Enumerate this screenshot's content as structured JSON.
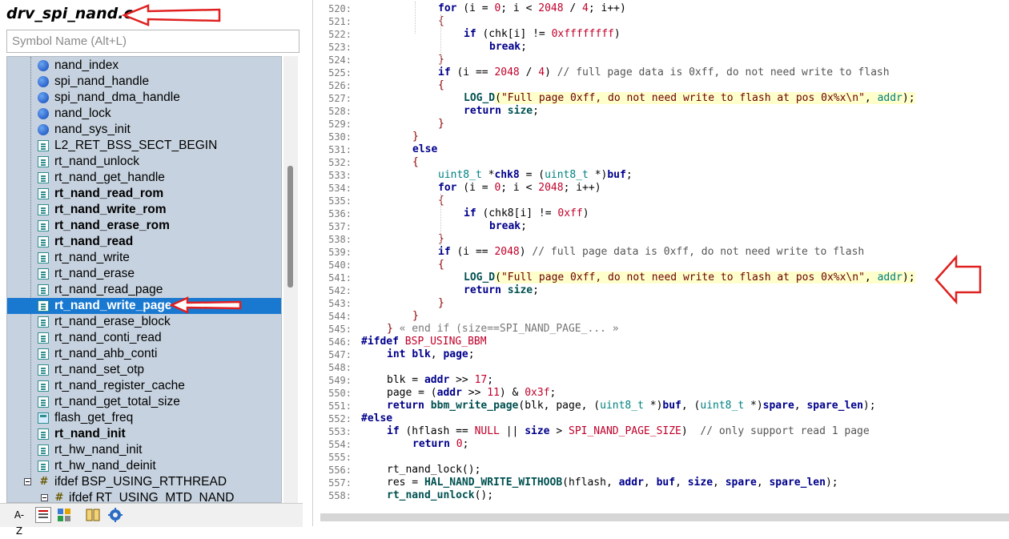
{
  "file_title": "drv_spi_nand.c",
  "search": {
    "placeholder": "Symbol Name (Alt+L)"
  },
  "tree": [
    {
      "label": "nand_index",
      "icon": "variable-icon",
      "bold": false,
      "selected": false
    },
    {
      "label": "spi_nand_handle",
      "icon": "variable-icon",
      "bold": false,
      "selected": false
    },
    {
      "label": "spi_nand_dma_handle",
      "icon": "variable-icon",
      "bold": false,
      "selected": false
    },
    {
      "label": "nand_lock",
      "icon": "variable-icon",
      "bold": false,
      "selected": false
    },
    {
      "label": "nand_sys_init",
      "icon": "variable-icon",
      "bold": false,
      "selected": false
    },
    {
      "label": "L2_RET_BSS_SECT_BEGIN",
      "icon": "function-icon",
      "bold": false,
      "selected": false
    },
    {
      "label": "rt_nand_unlock",
      "icon": "function-icon",
      "bold": false,
      "selected": false
    },
    {
      "label": "rt_nand_get_handle",
      "icon": "function-icon",
      "bold": false,
      "selected": false
    },
    {
      "label": "rt_nand_read_rom",
      "icon": "function-icon",
      "bold": true,
      "selected": false
    },
    {
      "label": "rt_nand_write_rom",
      "icon": "function-icon",
      "bold": true,
      "selected": false
    },
    {
      "label": "rt_nand_erase_rom",
      "icon": "function-icon",
      "bold": true,
      "selected": false
    },
    {
      "label": "rt_nand_read",
      "icon": "function-icon",
      "bold": true,
      "selected": false
    },
    {
      "label": "rt_nand_write",
      "icon": "function-icon",
      "bold": false,
      "selected": false
    },
    {
      "label": "rt_nand_erase",
      "icon": "function-icon",
      "bold": false,
      "selected": false
    },
    {
      "label": "rt_nand_read_page",
      "icon": "function-icon",
      "bold": false,
      "selected": false
    },
    {
      "label": "rt_nand_write_page",
      "icon": "function-icon",
      "bold": true,
      "selected": true
    },
    {
      "label": "rt_nand_erase_block",
      "icon": "function-icon",
      "bold": false,
      "selected": false
    },
    {
      "label": "rt_nand_conti_read",
      "icon": "function-icon",
      "bold": false,
      "selected": false
    },
    {
      "label": "rt_nand_ahb_conti",
      "icon": "function-icon",
      "bold": false,
      "selected": false
    },
    {
      "label": "rt_nand_set_otp",
      "icon": "function-icon",
      "bold": false,
      "selected": false
    },
    {
      "label": "rt_nand_register_cache",
      "icon": "function-icon",
      "bold": false,
      "selected": false
    },
    {
      "label": "rt_nand_get_total_size",
      "icon": "function-icon",
      "bold": false,
      "selected": false
    },
    {
      "label": "flash_get_freq",
      "icon": "function-prototype-icon",
      "bold": false,
      "selected": false
    },
    {
      "label": "rt_nand_init",
      "icon": "function-icon",
      "bold": true,
      "selected": false
    },
    {
      "label": "rt_hw_nand_init",
      "icon": "function-icon",
      "bold": false,
      "selected": false
    },
    {
      "label": "rt_hw_nand_deinit",
      "icon": "function-icon",
      "bold": false,
      "selected": false
    }
  ],
  "tree_groups": [
    {
      "label": "ifdef BSP_USING_RTTHREAD",
      "icon": "preprocessor-icon"
    },
    {
      "label": "ifdef RT_USING_MTD_NAND",
      "icon": "preprocessor-icon"
    }
  ],
  "toolbar": {
    "sort_label": "A-Z"
  },
  "line_numbers": [
    "520:",
    "521:",
    "522:",
    "523:",
    "524:",
    "525:",
    "526:",
    "527:",
    "528:",
    "529:",
    "530:",
    "531:",
    "532:",
    "533:",
    "534:",
    "535:",
    "536:",
    "537:",
    "538:",
    "539:",
    "540:",
    "541:",
    "542:",
    "543:",
    "544:",
    "545:",
    "546:",
    "547:",
    "548:",
    "549:",
    "550:",
    "551:",
    "552:",
    "553:",
    "554:",
    "555:",
    "556:",
    "557:",
    "558:"
  ],
  "code": {
    "l520": [
      [
        "kw",
        "for"
      ],
      [
        "t",
        " (i = "
      ],
      [
        "num",
        "0"
      ],
      [
        "t",
        "; i < "
      ],
      [
        "num",
        "2048"
      ],
      [
        "t",
        " / "
      ],
      [
        "num",
        "4"
      ],
      [
        "t",
        "; i++)"
      ]
    ],
    "l521": [
      [
        "br",
        "{"
      ]
    ],
    "l522": [
      [
        "kw",
        "if"
      ],
      [
        "t",
        " (chk[i] != "
      ],
      [
        "num",
        "0xffffffff"
      ],
      [
        "t",
        ")"
      ]
    ],
    "l523": [
      [
        "kw",
        "break"
      ],
      [
        "t",
        ";"
      ]
    ],
    "l524": [
      [
        "br",
        "}"
      ]
    ],
    "l525": [
      [
        "kw",
        "if"
      ],
      [
        "t",
        " (i == "
      ],
      [
        "num",
        "2048"
      ],
      [
        "t",
        " / "
      ],
      [
        "num",
        "4"
      ],
      [
        "t",
        ") "
      ],
      [
        "cmt",
        "// full page data is 0xff, do not need write to flash"
      ]
    ],
    "l526": [
      [
        "br",
        "{"
      ]
    ],
    "l527": [
      [
        "fnc",
        "LOG_D"
      ],
      [
        "t",
        "("
      ],
      [
        "str",
        "\"Full page 0xff, do not need write to flash at pos 0x%x\\n\""
      ],
      [
        "t",
        ", "
      ],
      [
        "teal",
        "addr"
      ],
      [
        "t",
        ");"
      ]
    ],
    "l528": [
      [
        "kw",
        "return"
      ],
      [
        "t",
        " "
      ],
      [
        "fnc",
        "size"
      ],
      [
        "t",
        ";"
      ]
    ],
    "l529": [
      [
        "br",
        "}"
      ]
    ],
    "l530": [
      [
        "br",
        "}"
      ]
    ],
    "l531": [
      [
        "kw",
        "else"
      ]
    ],
    "l532": [
      [
        "br",
        "{"
      ]
    ],
    "l533": [
      [
        "teal",
        "uint8_t"
      ],
      [
        "t",
        " *"
      ],
      [
        "kw",
        "chk8"
      ],
      [
        "t",
        " = ("
      ],
      [
        "teal",
        "uint8_t"
      ],
      [
        "t",
        " *)"
      ],
      [
        "kw",
        "buf"
      ],
      [
        "t",
        ";"
      ]
    ],
    "l534": [
      [
        "kw",
        "for"
      ],
      [
        "t",
        " (i = "
      ],
      [
        "num",
        "0"
      ],
      [
        "t",
        "; i < "
      ],
      [
        "num",
        "2048"
      ],
      [
        "t",
        "; i++)"
      ]
    ],
    "l535": [
      [
        "br",
        "{"
      ]
    ],
    "l536": [
      [
        "kw",
        "if"
      ],
      [
        "t",
        " (chk8[i] != "
      ],
      [
        "num",
        "0xff"
      ],
      [
        "t",
        ")"
      ]
    ],
    "l537": [
      [
        "kw",
        "break"
      ],
      [
        "t",
        ";"
      ]
    ],
    "l538": [
      [
        "br",
        "}"
      ]
    ],
    "l539": [
      [
        "kw",
        "if"
      ],
      [
        "t",
        " (i == "
      ],
      [
        "num",
        "2048"
      ],
      [
        "t",
        ") "
      ],
      [
        "cmt",
        "// full page data is 0xff, do not need write to flash"
      ]
    ],
    "l540": [
      [
        "br",
        "{"
      ]
    ],
    "l541": [
      [
        "fnc",
        "LOG_D"
      ],
      [
        "t",
        "("
      ],
      [
        "str",
        "\"Full page 0xff, do not need write to flash at pos 0x%x\\n\""
      ],
      [
        "t",
        ", "
      ],
      [
        "teal",
        "addr"
      ],
      [
        "t",
        ");"
      ]
    ],
    "l542": [
      [
        "kw",
        "return"
      ],
      [
        "t",
        " "
      ],
      [
        "fnc",
        "size"
      ],
      [
        "t",
        ";"
      ]
    ],
    "l543": [
      [
        "br",
        "}"
      ]
    ],
    "l544": [
      [
        "br",
        "}"
      ]
    ],
    "l545": [
      [
        "br",
        "}"
      ],
      [
        "fold",
        " « end if (size==SPI_NAND_PAGE_... »"
      ]
    ],
    "l546": [
      [
        "pp",
        "#ifdef"
      ],
      [
        "t",
        " "
      ],
      [
        "mac",
        "BSP_USING_BBM"
      ]
    ],
    "l547": [
      [
        "kw",
        "int"
      ],
      [
        "t",
        " "
      ],
      [
        "kw",
        "blk"
      ],
      [
        "t",
        ", "
      ],
      [
        "kw",
        "page"
      ],
      [
        "t",
        ";"
      ]
    ],
    "l548": [],
    "l549": [
      [
        "t",
        "blk = "
      ],
      [
        "kw",
        "addr"
      ],
      [
        "t",
        " >> "
      ],
      [
        "num",
        "17"
      ],
      [
        "t",
        ";"
      ]
    ],
    "l550": [
      [
        "t",
        "page = ("
      ],
      [
        "kw",
        "addr"
      ],
      [
        "t",
        " >> "
      ],
      [
        "num",
        "11"
      ],
      [
        "t",
        ") & "
      ],
      [
        "num",
        "0x3f"
      ],
      [
        "t",
        ";"
      ]
    ],
    "l551": [
      [
        "kw",
        "return"
      ],
      [
        "t",
        " "
      ],
      [
        "fnc",
        "bbm_write_page"
      ],
      [
        "t",
        "(blk, page, ("
      ],
      [
        "teal",
        "uint8_t"
      ],
      [
        "t",
        " *)"
      ],
      [
        "kw",
        "buf"
      ],
      [
        "t",
        ", ("
      ],
      [
        "teal",
        "uint8_t"
      ],
      [
        "t",
        " *)"
      ],
      [
        "kw",
        "spare"
      ],
      [
        "t",
        ", "
      ],
      [
        "kw",
        "spare_len"
      ],
      [
        "t",
        ");"
      ]
    ],
    "l552": [
      [
        "pp",
        "#else"
      ]
    ],
    "l553": [
      [
        "kw",
        "if"
      ],
      [
        "t",
        " (hflash == "
      ],
      [
        "mac",
        "NULL"
      ],
      [
        "t",
        " || "
      ],
      [
        "kw",
        "size"
      ],
      [
        "t",
        " > "
      ],
      [
        "mac",
        "SPI_NAND_PAGE_SIZE"
      ],
      [
        "t",
        ")  "
      ],
      [
        "cmt",
        "// only support read 1 page"
      ]
    ],
    "l554": [
      [
        "kw",
        "return"
      ],
      [
        "t",
        " "
      ],
      [
        "num",
        "0"
      ],
      [
        "t",
        ";"
      ]
    ],
    "l555": [],
    "l556": [
      [
        "t",
        "rt_nand_lock();"
      ]
    ],
    "l557": [
      [
        "t",
        "res = "
      ],
      [
        "fnc",
        "HAL_NAND_WRITE_WITHOOB"
      ],
      [
        "t",
        "(hflash, "
      ],
      [
        "kw",
        "addr"
      ],
      [
        "t",
        ", "
      ],
      [
        "kw",
        "buf"
      ],
      [
        "t",
        ", "
      ],
      [
        "kw",
        "size"
      ],
      [
        "t",
        ", "
      ],
      [
        "kw",
        "spare"
      ],
      [
        "t",
        ", "
      ],
      [
        "kw",
        "spare_len"
      ],
      [
        "t",
        ");"
      ]
    ],
    "l558": [
      [
        "fnc",
        "rt_nand_unlock"
      ],
      [
        "t",
        "();"
      ]
    ]
  },
  "colors": {
    "selection": "#1979d1",
    "tree_bg": "#c6d2df",
    "arrow": "#e02020",
    "highlight": "#ffffcc"
  }
}
